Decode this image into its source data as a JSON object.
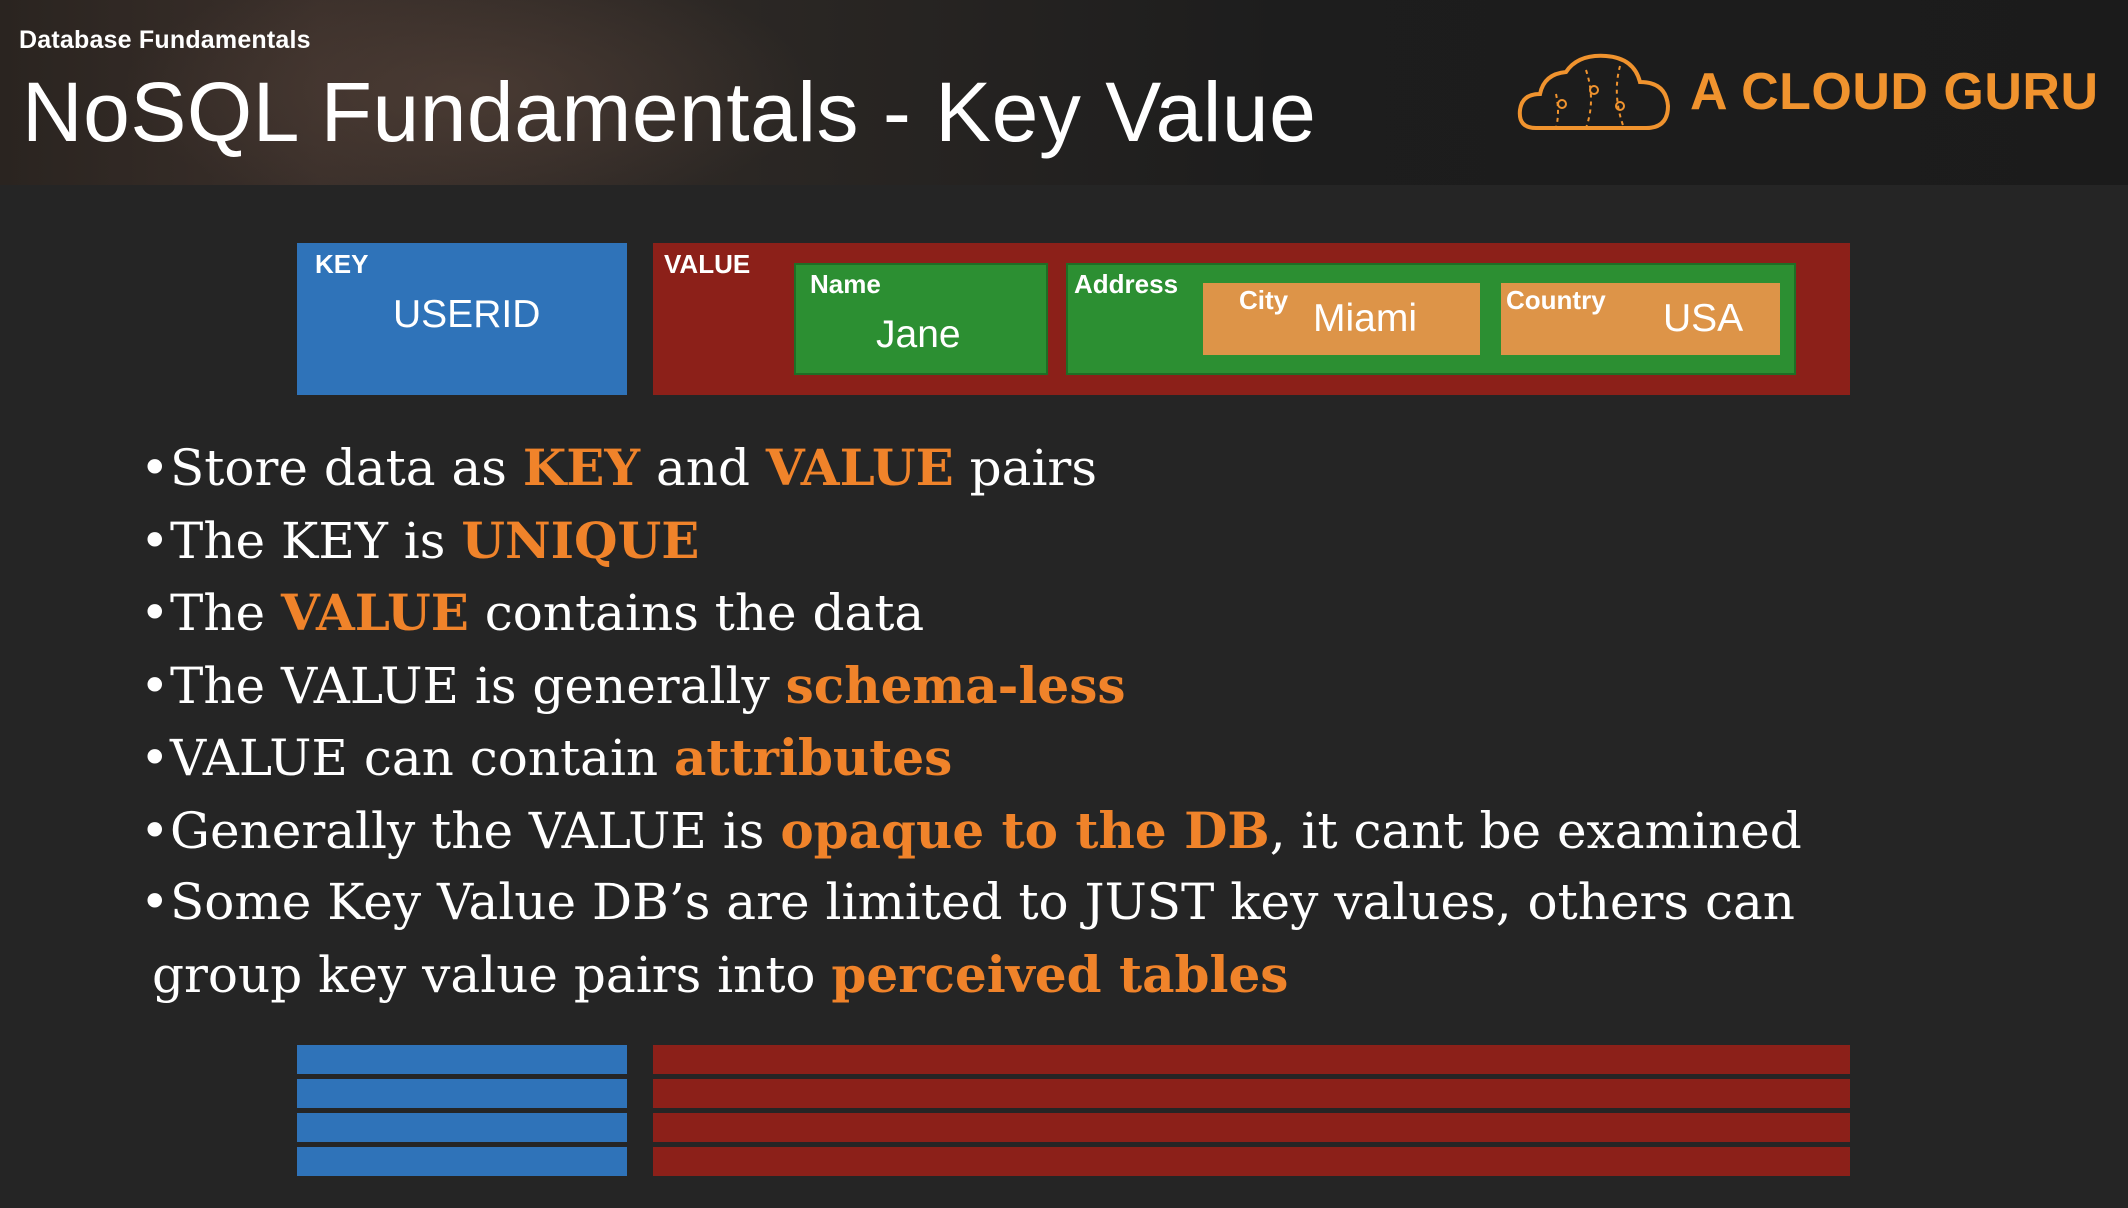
{
  "header": {
    "course": "Database Fundamentals",
    "title": "NoSQL Fundamentals - Key Value",
    "brand": "A CLOUD GURU",
    "logo_icon": "cloud-logo-icon",
    "brand_color": "#f0932e"
  },
  "diagram": {
    "key": {
      "label": "KEY",
      "value": "USERID",
      "color": "#2f73b9"
    },
    "value": {
      "label": "VALUE",
      "color": "#8c2019"
    },
    "name": {
      "label": "Name",
      "value": "Jane",
      "color": "#2c8f32"
    },
    "address": {
      "label": "Address"
    },
    "city": {
      "label": "City",
      "value": "Miami",
      "color": "#dd9448"
    },
    "country": {
      "label": "Country",
      "value": "USA"
    }
  },
  "bullets": [
    {
      "parts": [
        {
          "t": "Store data as "
        },
        {
          "t": "KEY",
          "hl": true
        },
        {
          "t": " and "
        },
        {
          "t": "VALUE",
          "hl": true
        },
        {
          "t": " pairs"
        }
      ]
    },
    {
      "parts": [
        {
          "t": "The KEY is "
        },
        {
          "t": "UNIQUE",
          "hl": true
        }
      ]
    },
    {
      "parts": [
        {
          "t": "The "
        },
        {
          "t": "VALUE",
          "hl": true
        },
        {
          "t": " contains the data"
        }
      ]
    },
    {
      "parts": [
        {
          "t": "The VALUE is generally "
        },
        {
          "t": "schema-less",
          "hl": true
        }
      ]
    },
    {
      "parts": [
        {
          "t": "VALUE can contain "
        },
        {
          "t": "attributes",
          "hl": true
        }
      ]
    },
    {
      "parts": [
        {
          "t": "Generally the VALUE is "
        },
        {
          "t": "opaque to the DB",
          "hl": true
        },
        {
          "t": ", it cant be examined"
        }
      ]
    },
    {
      "parts": [
        {
          "t": "Some Key Value DB’s are limited to JUST key values, others can"
        }
      ]
    },
    {
      "cont": true,
      "parts": [
        {
          "t": "group key value pairs into "
        },
        {
          "t": "perceived tables",
          "hl": true
        }
      ]
    }
  ],
  "highlight_color": "#f0832a",
  "table_rows": 4
}
